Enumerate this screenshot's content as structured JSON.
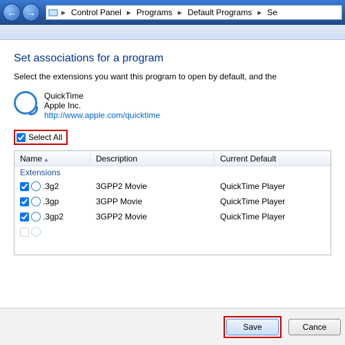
{
  "breadcrumb": {
    "items": [
      "Control Panel",
      "Programs",
      "Default Programs",
      "Se"
    ]
  },
  "page": {
    "title": "Set associations for a program",
    "subtitle": "Select the extensions you want this program to open by default, and the"
  },
  "program": {
    "name": "QuickTime",
    "vendor": "Apple Inc.",
    "url": "http://www.apple.com/quicktime"
  },
  "select_all": {
    "label": "Select All",
    "checked": true
  },
  "columns": {
    "c1": "Name",
    "c2": "Description",
    "c3": "Current Default"
  },
  "group_label": "Extensions",
  "rows": [
    {
      "checked": true,
      "ext": ".3g2",
      "desc": "3GPP2 Movie",
      "def": "QuickTime Player"
    },
    {
      "checked": true,
      "ext": ".3gp",
      "desc": "3GPP Movie",
      "def": "QuickTime Player"
    },
    {
      "checked": true,
      "ext": ".3gp2",
      "desc": "3GPP2 Movie",
      "def": "QuickTime Player"
    }
  ],
  "buttons": {
    "save": "Save",
    "cancel": "Cance"
  }
}
